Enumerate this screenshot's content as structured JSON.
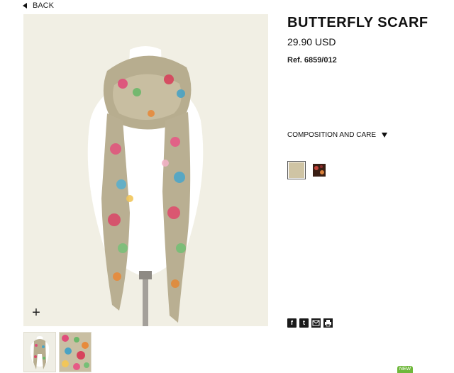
{
  "nav": {
    "back_label": "BACK"
  },
  "product": {
    "title": "BUTTERFLY SCARF",
    "price": "29.90 USD",
    "ref": "Ref. 6859/012",
    "composition_label": "COMPOSITION AND CARE"
  },
  "gallery": {
    "zoom_symbol": "+"
  },
  "swatches": [
    {
      "name": "beige",
      "color": "#cfc4a4"
    },
    {
      "name": "dark",
      "color": "#3a1f14"
    }
  ],
  "share": {
    "icons": [
      "facebook-icon",
      "twitter-icon",
      "email-icon",
      "print-icon"
    ]
  },
  "badge": {
    "label": "NEW"
  }
}
